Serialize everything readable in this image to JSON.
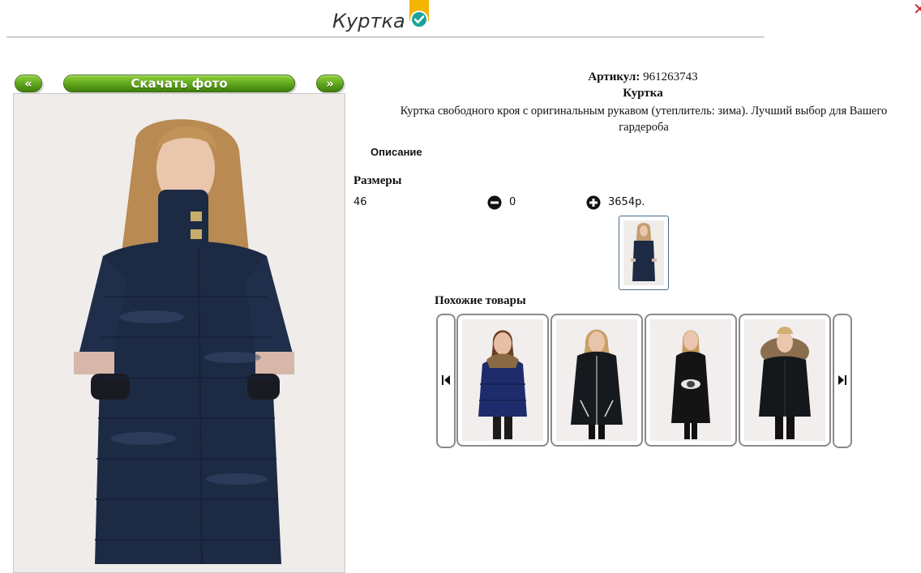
{
  "header": {
    "title": "Куртка",
    "badge_icon": "check-circle-icon",
    "badge_color": "#f4b400"
  },
  "gallery": {
    "prev_label": "«",
    "download_label": "Скачать фото",
    "next_label": "»"
  },
  "product": {
    "sku_label": "Артикул:",
    "sku_value": "961263743",
    "name": "Куртка",
    "description": "Куртка свободного кроя с оригинальным рукавом (утеплитель: зима). Лучший выбор для Вашего гардероба",
    "description_tab": "Описание",
    "sizes_heading": "Размеры",
    "size": "46",
    "quantity": "0",
    "price": "3654р.",
    "minus_icon": "minus-circle-icon",
    "plus_icon": "plus-circle-icon"
  },
  "similar": {
    "heading": "Похожие товары",
    "prev_icon": "skip-back-icon",
    "next_icon": "skip-forward-icon",
    "items": [
      {
        "jacket_color": "#1f2c6b"
      },
      {
        "jacket_color": "#161a1e"
      },
      {
        "jacket_color": "#141414"
      },
      {
        "jacket_color": "#14181a"
      }
    ]
  },
  "colors": {
    "accent_green": "#5ea41c",
    "jacket_navy": "#1c2a44"
  }
}
